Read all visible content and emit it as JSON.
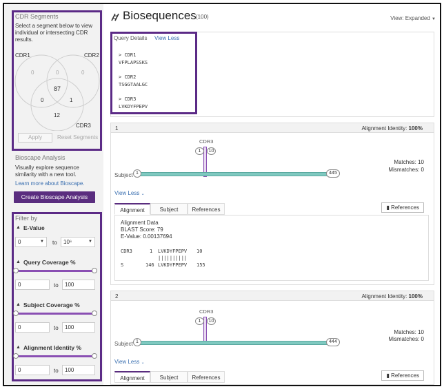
{
  "sidebar": {
    "cdr_segments": {
      "title": "CDR Segments",
      "description": "Select a segment below to view individual or intersecting CDR results.",
      "labels": {
        "cdr1": "CDR1",
        "cdr2": "CDR2",
        "cdr3": "CDR3"
      },
      "values": {
        "cdr1_only": "0",
        "cdr2_only": "0",
        "cdr1_cdr2": "0",
        "all": "87",
        "cdr1_cdr3": "0",
        "cdr2_cdr3": "1",
        "cdr3_only": "12"
      },
      "apply_label": "Apply",
      "reset_label": "Reset Segments"
    },
    "bioscape": {
      "title": "Bioscape Analysis",
      "description": "Visually explore sequence similarity with a new tool.",
      "learn_more": "Learn more about Bioscape.",
      "button_label": "Create Bioscape Analysis"
    },
    "filter": {
      "title": "Filter by",
      "evalue": {
        "label": "E-Value",
        "from": "0",
        "to_label": "to",
        "to_value": "10⁶"
      },
      "query_coverage": {
        "label": "Query Coverage %",
        "min": "0",
        "max": "100",
        "to_label": "to"
      },
      "subject_coverage": {
        "label": "Subject Coverage %",
        "min": "0",
        "max": "100",
        "to_label": "to"
      },
      "alignment_identity": {
        "label": "Alignment Identity %",
        "min": "0",
        "max": "100",
        "to_label": "to"
      }
    }
  },
  "header": {
    "title": "Biosequences",
    "count": "(100)",
    "view_label": "View:",
    "view_value": "Expanded"
  },
  "query": {
    "details_label": "Query Details",
    "view_less": "View Less",
    "items": [
      {
        "name": "CDR1",
        "seq": "VFPLAPSSKS"
      },
      {
        "name": "CDR2",
        "seq": "TSGGTAALGC"
      },
      {
        "name": "CDR3",
        "seq": "LVKDYFPEPV"
      }
    ]
  },
  "results": [
    {
      "index": "1",
      "identity_label": "Alignment Identity:",
      "identity_value": "100%",
      "cdr_label": "CDR3",
      "marker_start": "1",
      "marker_end": "10",
      "subject_label": "Subject",
      "subject_start": "1",
      "subject_end": "445",
      "matches": "Matches: 10",
      "mismatches": "Mismatches: 0",
      "view_less": "View Less",
      "tabs": [
        "Alignment",
        "Subject",
        "References"
      ],
      "references_btn": "References",
      "alignment": {
        "title": "Alignment Data",
        "blast": "BLAST Score: 79",
        "evalue": "E-Value: 0.00137694",
        "q_name": "CDR3",
        "q_start": "1",
        "q_seq": "LVKDYFPEPV",
        "q_end": "10",
        "bars": "||||||||||",
        "s_name": "S",
        "s_start": "146",
        "s_seq": "LVKDYFPEPV",
        "s_end": "155"
      }
    },
    {
      "index": "2",
      "identity_label": "Alignment Identity:",
      "identity_value": "100%",
      "cdr_label": "CDR3",
      "marker_start": "1",
      "marker_end": "10",
      "subject_label": "Subject",
      "subject_start": "1",
      "subject_end": "444",
      "matches": "Matches: 10",
      "mismatches": "Mismatches: 0",
      "view_less": "View Less",
      "tabs": [
        "Alignment",
        "Subject",
        "References"
      ],
      "references_btn": "References"
    }
  ],
  "colors": {
    "accent": "#5a2d7f",
    "bar": "#7fc9c0",
    "link": "#3a6fb0"
  }
}
